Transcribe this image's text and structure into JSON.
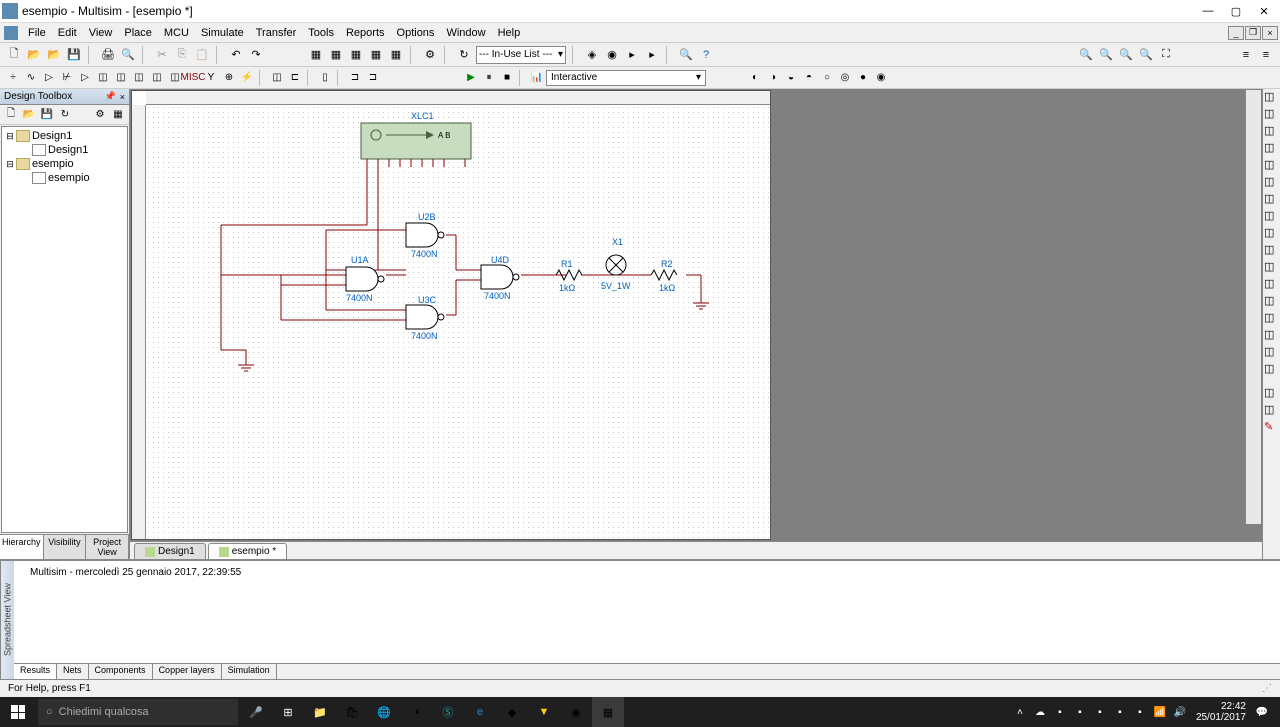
{
  "title": "esempio - Multisim - [esempio *]",
  "menus": [
    "File",
    "Edit",
    "View",
    "Place",
    "MCU",
    "Simulate",
    "Transfer",
    "Tools",
    "Reports",
    "Options",
    "Window",
    "Help"
  ],
  "inUseList": "--- In-Use List ---",
  "simMode": "Interactive",
  "toolbox": {
    "title": "Design Toolbox",
    "tree": {
      "root1": "Design1",
      "child1": "Design1",
      "root2": "esempio",
      "child2": "esempio"
    },
    "tabs": [
      "Hierarchy",
      "Visibility",
      "Project View"
    ]
  },
  "docTabs": [
    "Design1",
    "esempio *"
  ],
  "spreadsheet": {
    "sidebar": "Spreadsheet View",
    "content": "Multisim  -  mercoledì 25 gennaio 2017, 22:39:55",
    "tabs": [
      "Results",
      "Nets",
      "Components",
      "Copper layers",
      "Simulation"
    ]
  },
  "status": "For Help, press F1",
  "schematic": {
    "xlc1": "XLC1",
    "ab": "A B",
    "u1a": "U1A",
    "u1a_val": "7400N",
    "u2b": "U2B",
    "u2b_val": "7400N",
    "u3c": "U3C",
    "u3c_val": "7400N",
    "u4d": "U4D",
    "u4d_val": "7400N",
    "r1": "R1",
    "r1_val": "1kΩ",
    "x1": "X1",
    "x1_val": "5V_1W",
    "r2": "R2",
    "r2_val": "1kΩ"
  },
  "taskbar": {
    "search": "Chiedimi qualcosa",
    "time": "22:42",
    "date": "25/01/2017"
  }
}
